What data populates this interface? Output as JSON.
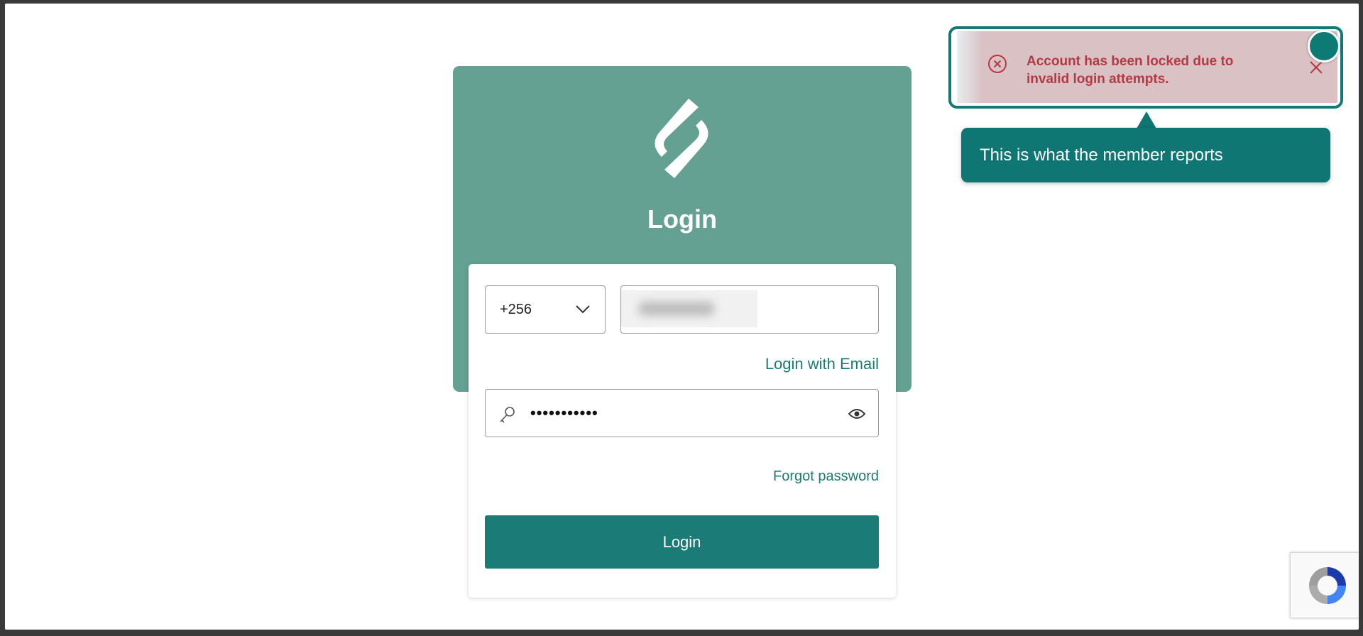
{
  "login": {
    "title": "Login",
    "country_code": "+256",
    "login_with_email": "Login with Email",
    "password_mask": "•••••••••••",
    "forgot_password": "Forgot password",
    "submit_label": "Login"
  },
  "toast": {
    "message": "Account has been locked due to invalid login attempts."
  },
  "callout": {
    "text": "This is what the member reports"
  },
  "colors": {
    "brand_panel": "#64a193",
    "primary": "#1b7c77",
    "error_text": "#b33a44",
    "toast_bg": "#d9c1c4",
    "callout_bg": "#0f7673"
  }
}
